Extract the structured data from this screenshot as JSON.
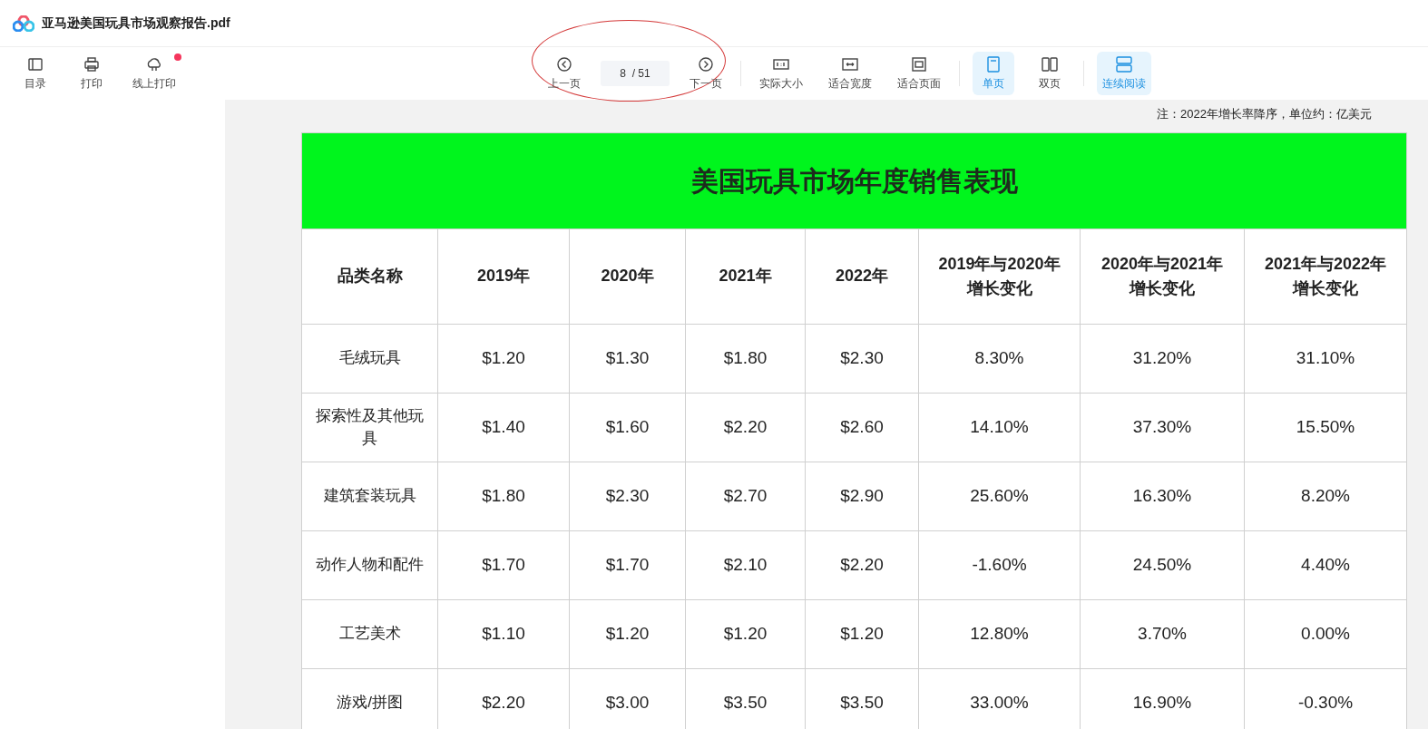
{
  "window": {
    "title": "亚马逊美国玩具市场观察报告.pdf"
  },
  "left_tools": [
    {
      "kind": "sidebar",
      "label": "目录",
      "dot": false
    },
    {
      "kind": "printer",
      "label": "打印",
      "dot": false
    },
    {
      "kind": "cloud",
      "label": "线上打印",
      "dot": true
    }
  ],
  "pager": {
    "prev": "上一页",
    "page": "8  / 51",
    "next": "下一页"
  },
  "view_groups": [
    [
      {
        "kind": "actual",
        "label": "实际大小",
        "selected": false
      },
      {
        "kind": "width",
        "label": "适合宽度",
        "selected": false
      },
      {
        "kind": "page",
        "label": "适合页面",
        "selected": false
      }
    ],
    [
      {
        "kind": "single",
        "label": "单页",
        "selected": true
      },
      {
        "kind": "double",
        "label": "双页",
        "selected": false
      }
    ],
    [
      {
        "kind": "continuous",
        "label": "连续阅读",
        "selected": true
      }
    ]
  ],
  "note": "注：2022年增长率降序，单位约：亿美元",
  "table": {
    "title": "美国玩具市场年度销售表现",
    "columns": [
      "品类名称",
      "2019年",
      "2020年",
      "2021年",
      "2022年",
      "2019年与2020年增长变化",
      "2020年与2021年增长变化",
      "2021年与2022年增长变化"
    ],
    "rows": [
      [
        "毛绒玩具",
        "$1.20",
        "$1.30",
        "$1.80",
        "$2.30",
        "8.30%",
        "31.20%",
        "31.10%"
      ],
      [
        "探索性及其他玩具",
        "$1.40",
        "$1.60",
        "$2.20",
        "$2.60",
        "14.10%",
        "37.30%",
        "15.50%"
      ],
      [
        "建筑套装玩具",
        "$1.80",
        "$2.30",
        "$2.70",
        "$2.90",
        "25.60%",
        "16.30%",
        "8.20%"
      ],
      [
        "动作人物和配件",
        "$1.70",
        "$1.70",
        "$2.10",
        "$2.20",
        "-1.60%",
        "24.50%",
        "4.40%"
      ],
      [
        "工艺美术",
        "$1.10",
        "$1.20",
        "$1.20",
        "$1.20",
        "12.80%",
        "3.70%",
        "0.00%"
      ],
      [
        "游戏/拼图",
        "$2.20",
        "$3.00",
        "$3.50",
        "$3.50",
        "33.00%",
        "16.90%",
        "-0.30%"
      ]
    ]
  }
}
